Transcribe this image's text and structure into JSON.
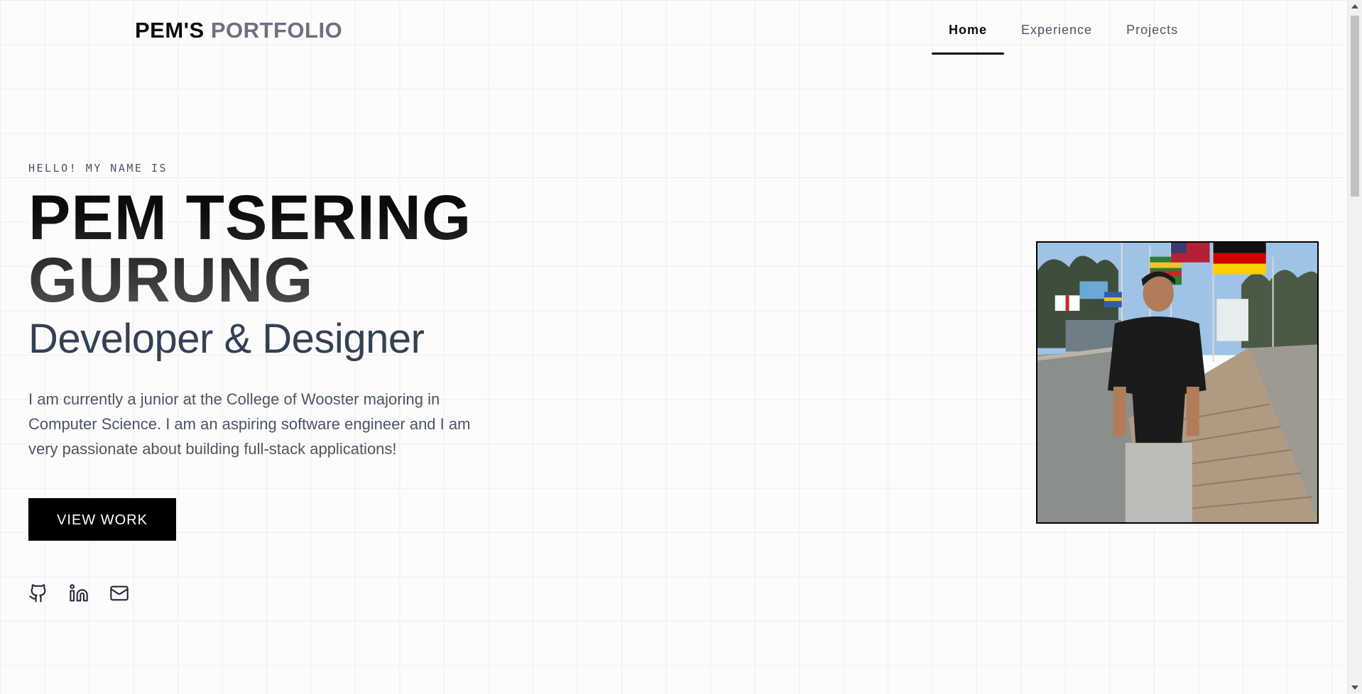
{
  "header": {
    "brand_primary": "PEM'S",
    "brand_accent": "PORTFOLIO",
    "nav": [
      {
        "label": "Home",
        "active": true
      },
      {
        "label": "Experience",
        "active": false
      },
      {
        "label": "Projects",
        "active": false
      }
    ]
  },
  "hero": {
    "greeting": "HELLO! MY NAME IS",
    "name_line1": "PEM TSERING",
    "name_line2": "GURUNG",
    "role": "Developer & Designer",
    "bio": "I am currently a junior at the College of Wooster majoring in Computer Science. I am an aspiring software engineer and I am very passionate about building full-stack applications!",
    "cta_label": "VIEW WORK"
  },
  "socials": [
    {
      "icon": "github-icon"
    },
    {
      "icon": "linkedin-icon"
    },
    {
      "icon": "mail-icon"
    }
  ],
  "colors": {
    "accent": "#6b7280",
    "text_dark": "#0b0b0b",
    "role_color": "#334155",
    "button_bg": "#000000"
  }
}
